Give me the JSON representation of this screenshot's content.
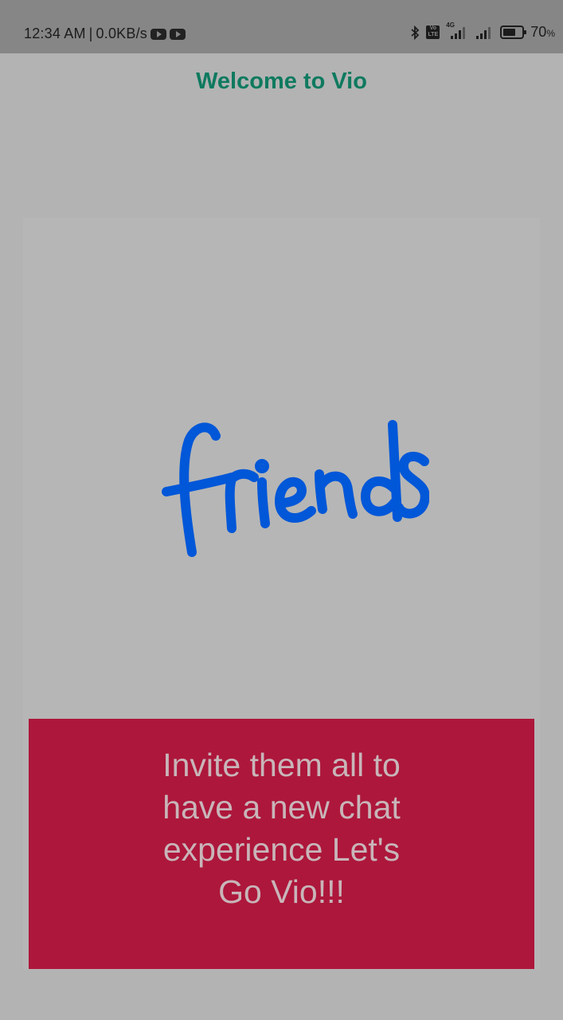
{
  "status_bar": {
    "time": "12:34 AM",
    "separator": "|",
    "net_speed": "0.0KB/s",
    "icons_left": [
      "youtube-icon",
      "youtube-icon"
    ],
    "icons_right": [
      "bluetooth-icon",
      "volte-icon",
      "signal-4g-icon",
      "signal-icon",
      "battery-icon"
    ],
    "network_label": "4G",
    "volte_label": "Vo LTE",
    "battery_percent": "70",
    "battery_sign": "%",
    "battery_level": 0.7
  },
  "header": {
    "title": "Welcome to Vio"
  },
  "card": {
    "art_word": "friends",
    "art_color": "#0057d8",
    "message": "Invite them all to have a new chat experience Let's Go Vio!!!",
    "panel_color": "#ad173b"
  },
  "colors": {
    "background": "#b3b3b3",
    "status_bar": "#868686",
    "title": "#0e7a5f"
  }
}
